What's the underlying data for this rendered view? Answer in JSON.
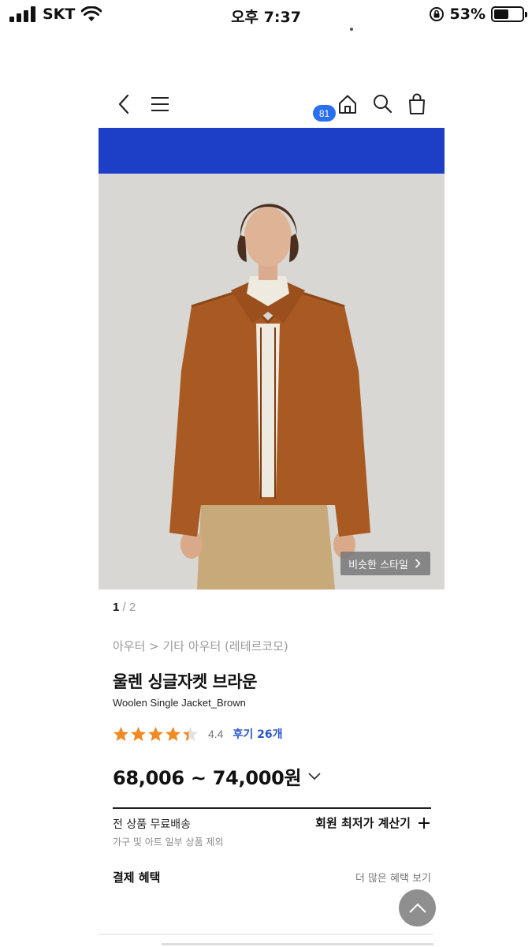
{
  "status_bar": {
    "carrier": "SKT",
    "time": "오후 7:37",
    "battery_percent": "53%",
    "battery_level": 0.53
  },
  "header": {
    "cart_count": "81",
    "icons": [
      "back-icon",
      "menu-icon",
      "home-icon",
      "search-icon",
      "shopping-bag-icon"
    ]
  },
  "banner": {
    "color": "#1d3fc8"
  },
  "gallery": {
    "current_page": "1",
    "total_pages": "/ 2",
    "similar_style_label": "비슷한 스타일"
  },
  "product": {
    "breadcrumb": "아우터 > 기타 아우터 (레테르코모)",
    "name_ko": "울렌 싱글자켓 브라운",
    "name_en": "Woolen Single Jacket_Brown",
    "rating": "4.4",
    "rating_value": 4.4,
    "review_label": "후기 26개",
    "price_range": "68,006 ~ 74,000원",
    "star_color": "#f08a24"
  },
  "shipping": {
    "title": "전 상품 무료배송",
    "subtitle": "가구 및 아트 일부 상품 제외",
    "calculator_label": "회원 최저가 계산기"
  },
  "payment": {
    "title": "결제 혜택",
    "more_label": "더 많은 혜택 보기"
  }
}
